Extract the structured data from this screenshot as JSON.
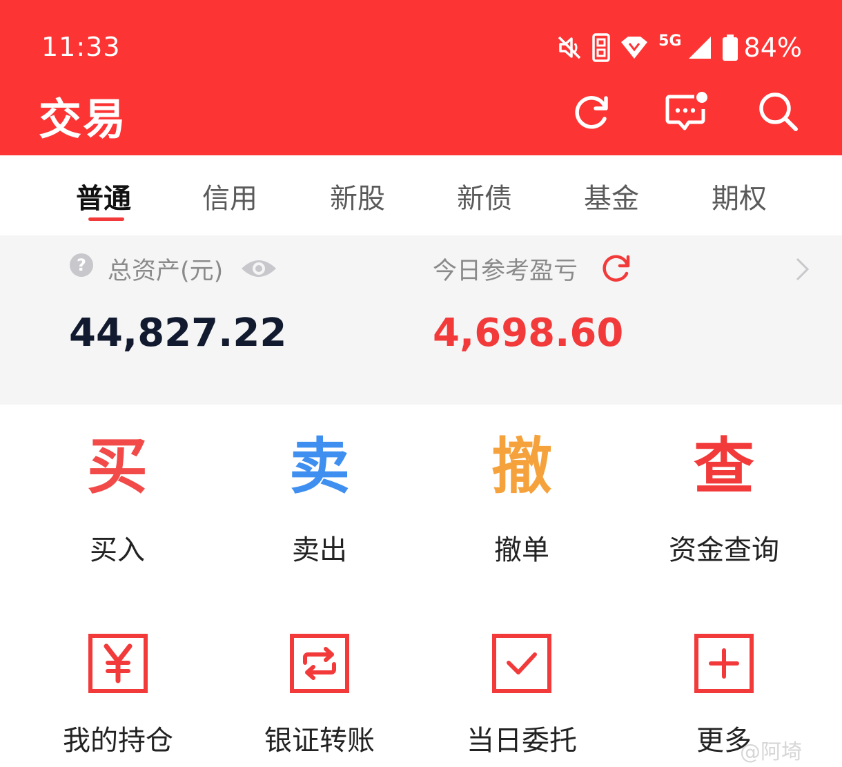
{
  "status_bar": {
    "time": "11:33",
    "network": "5G",
    "battery": "84%",
    "icons": [
      "mute-icon",
      "data-icon",
      "wifi-icon",
      "signal-icon",
      "battery-icon"
    ]
  },
  "header": {
    "title": "交易",
    "actions": [
      "refresh-icon",
      "message-icon",
      "search-icon"
    ]
  },
  "tabs": [
    {
      "label": "普通",
      "active": true
    },
    {
      "label": "信用",
      "active": false
    },
    {
      "label": "新股",
      "active": false
    },
    {
      "label": "新债",
      "active": false
    },
    {
      "label": "基金",
      "active": false
    },
    {
      "label": "期权",
      "active": false
    }
  ],
  "assets": {
    "total_label": "总资产(元)",
    "total_value": "44,827.22",
    "pl_label": "今日参考盈亏",
    "pl_value": "4,698.60"
  },
  "actions_row1": [
    {
      "glyph": "买",
      "label": "买入",
      "color": "#f24a48"
    },
    {
      "glyph": "卖",
      "label": "卖出",
      "color": "#3f8ff0"
    },
    {
      "glyph": "撤",
      "label": "撤单",
      "color": "#f5a23c"
    },
    {
      "glyph": "查",
      "label": "资金查询",
      "color": "#f23a3a"
    }
  ],
  "actions_row2": [
    {
      "icon": "yen-box-icon",
      "label": "我的持仓"
    },
    {
      "icon": "transfer-box-icon",
      "label": "银证转账"
    },
    {
      "icon": "check-box-icon",
      "label": "当日委托"
    },
    {
      "icon": "plus-box-icon",
      "label": "更多"
    }
  ],
  "watermark": "@阿埼",
  "colors": {
    "brand_red": "#fc3434",
    "accent_red": "#f23a3a",
    "card_bg": "#f5f5f6"
  }
}
